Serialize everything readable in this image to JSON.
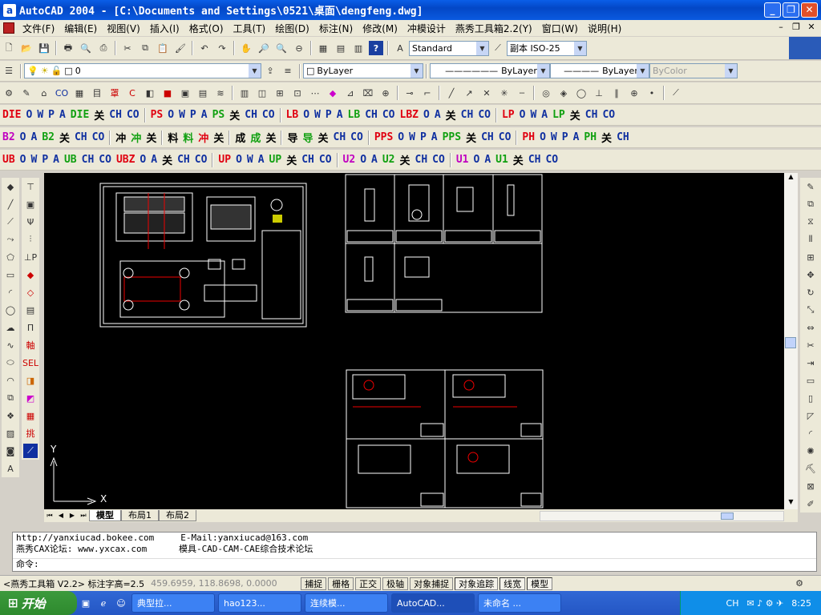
{
  "window": {
    "title": "AutoCAD 2004 - [C:\\Documents and Settings\\0521\\桌面\\dengfeng.dwg]",
    "app_icon": "a"
  },
  "menu": [
    "文件(F)",
    "编辑(E)",
    "视图(V)",
    "插入(I)",
    "格式(O)",
    "工具(T)",
    "绘图(D)",
    "标注(N)",
    "修改(M)",
    "冲模设计",
    "燕秀工具箱2.2(Y)",
    "窗口(W)",
    "说明(H)"
  ],
  "toolbar": {
    "text_style": "Standard",
    "dim_style": "副本 ISO-25",
    "layer": "0",
    "color": "ByLayer",
    "linetype": "ByLayer",
    "lineweight": "ByLayer",
    "plotstyle": "ByColor"
  },
  "custom_rows": [
    [
      [
        "DIE",
        "red"
      ],
      [
        "O",
        "blue"
      ],
      [
        "W",
        "blue"
      ],
      [
        "P",
        "blue"
      ],
      [
        "A",
        "blue"
      ],
      [
        "DIE",
        "green"
      ],
      [
        "关",
        "blk"
      ],
      [
        "CH",
        "blue"
      ],
      [
        "CO",
        "blue"
      ],
      [
        "|",
        "blk"
      ],
      [
        "PS",
        "red"
      ],
      [
        "O",
        "blue"
      ],
      [
        "W",
        "blue"
      ],
      [
        "P",
        "blue"
      ],
      [
        "A",
        "blue"
      ],
      [
        "PS",
        "green"
      ],
      [
        "关",
        "blk"
      ],
      [
        "CH",
        "blue"
      ],
      [
        "CO",
        "blue"
      ],
      [
        "|",
        "blk"
      ],
      [
        "LB",
        "red"
      ],
      [
        "O",
        "blue"
      ],
      [
        "W",
        "blue"
      ],
      [
        "P",
        "blue"
      ],
      [
        "A",
        "blue"
      ],
      [
        "LB",
        "green"
      ],
      [
        "CH",
        "blue"
      ],
      [
        "CO",
        "blue"
      ],
      [
        "LBZ",
        "red"
      ],
      [
        "O",
        "blue"
      ],
      [
        "A",
        "blue"
      ],
      [
        "关",
        "blk"
      ],
      [
        "CH",
        "blue"
      ],
      [
        "CO",
        "blue"
      ],
      [
        "|",
        "blk"
      ],
      [
        "LP",
        "red"
      ],
      [
        "O",
        "blue"
      ],
      [
        "W",
        "blue"
      ],
      [
        "A",
        "blue"
      ],
      [
        "LP",
        "green"
      ],
      [
        "关",
        "blk"
      ],
      [
        "CH",
        "blue"
      ],
      [
        "CO",
        "blue"
      ]
    ],
    [
      [
        "B2",
        "mag"
      ],
      [
        "O",
        "blue"
      ],
      [
        "A",
        "blue"
      ],
      [
        "B2",
        "green"
      ],
      [
        "关",
        "blk"
      ],
      [
        "CH",
        "blue"
      ],
      [
        "CO",
        "blue"
      ],
      [
        "|",
        "blk"
      ],
      [
        "冲",
        "blk"
      ],
      [
        "冲",
        "green"
      ],
      [
        "关",
        "blk"
      ],
      [
        "|",
        "blk"
      ],
      [
        "料",
        "blk"
      ],
      [
        "料",
        "green"
      ],
      [
        "冲",
        "red"
      ],
      [
        "关",
        "blk"
      ],
      [
        "|",
        "blk"
      ],
      [
        "成",
        "blk"
      ],
      [
        "成",
        "green"
      ],
      [
        "关",
        "blk"
      ],
      [
        "|",
        "blk"
      ],
      [
        "导",
        "blk"
      ],
      [
        "导",
        "green"
      ],
      [
        "关",
        "blk"
      ],
      [
        "CH",
        "blue"
      ],
      [
        "CO",
        "blue"
      ],
      [
        "|",
        "blk"
      ],
      [
        "PPS",
        "red"
      ],
      [
        "O",
        "blue"
      ],
      [
        "W",
        "blue"
      ],
      [
        "P",
        "blue"
      ],
      [
        "A",
        "blue"
      ],
      [
        "PPS",
        "green"
      ],
      [
        "关",
        "blk"
      ],
      [
        "CH",
        "blue"
      ],
      [
        "CO",
        "blue"
      ],
      [
        "|",
        "blk"
      ],
      [
        "PH",
        "red"
      ],
      [
        "O",
        "blue"
      ],
      [
        "W",
        "blue"
      ],
      [
        "P",
        "blue"
      ],
      [
        "A",
        "blue"
      ],
      [
        "PH",
        "green"
      ],
      [
        "关",
        "blk"
      ],
      [
        "CH",
        "blue"
      ]
    ],
    [
      [
        "UB",
        "red"
      ],
      [
        "O",
        "blue"
      ],
      [
        "W",
        "blue"
      ],
      [
        "P",
        "blue"
      ],
      [
        "A",
        "blue"
      ],
      [
        "UB",
        "green"
      ],
      [
        "CH",
        "blue"
      ],
      [
        "CO",
        "blue"
      ],
      [
        "UBZ",
        "red"
      ],
      [
        "O",
        "blue"
      ],
      [
        "A",
        "blue"
      ],
      [
        "关",
        "blk"
      ],
      [
        "CH",
        "blue"
      ],
      [
        "CO",
        "blue"
      ],
      [
        "|",
        "blk"
      ],
      [
        "UP",
        "red"
      ],
      [
        "O",
        "blue"
      ],
      [
        "W",
        "blue"
      ],
      [
        "A",
        "blue"
      ],
      [
        "UP",
        "green"
      ],
      [
        "关",
        "blk"
      ],
      [
        "CH",
        "blue"
      ],
      [
        "CO",
        "blue"
      ],
      [
        "|",
        "blk"
      ],
      [
        "U2",
        "mag"
      ],
      [
        "O",
        "blue"
      ],
      [
        "A",
        "blue"
      ],
      [
        "U2",
        "green"
      ],
      [
        "关",
        "blk"
      ],
      [
        "CH",
        "blue"
      ],
      [
        "CO",
        "blue"
      ],
      [
        "|",
        "blk"
      ],
      [
        "U1",
        "mag"
      ],
      [
        "O",
        "blue"
      ],
      [
        "A",
        "blue"
      ],
      [
        "U1",
        "green"
      ],
      [
        "关",
        "blk"
      ],
      [
        "CH",
        "blue"
      ],
      [
        "CO",
        "blue"
      ]
    ]
  ],
  "colors": {
    "red": "#e00010",
    "blue": "#1030a0",
    "green": "#10a010",
    "blk": "#000000",
    "mag": "#c000c0"
  },
  "canvas": {
    "y_label": "Y",
    "x_label": "X"
  },
  "layout_tabs": [
    "模型",
    "布局1",
    "布局2"
  ],
  "command": {
    "line1": "http://yanxiucad.bokee.com     E-Mail:yanxiucad@163.com",
    "line2": "燕秀CAX论坛: www.yxcax.com      模具-CAD-CAM-CAE综合技术论坛",
    "prompt": "命令:"
  },
  "status": {
    "left": "<燕秀工具箱 V2.2> 标注字高=2.5",
    "coords": "459.6959, 118.8698, 0.0000",
    "toggles": [
      "捕捉",
      "栅格",
      "正交",
      "极轴",
      "对象捕捉",
      "对象追踪",
      "线宽",
      "模型"
    ]
  },
  "taskbar": {
    "start": "开始",
    "tasks": [
      "典型拉...",
      "hao123...",
      "连续模...",
      "AutoCAD...",
      "未命名 ..."
    ],
    "tray_lang": "CH",
    "time": "8:25"
  }
}
